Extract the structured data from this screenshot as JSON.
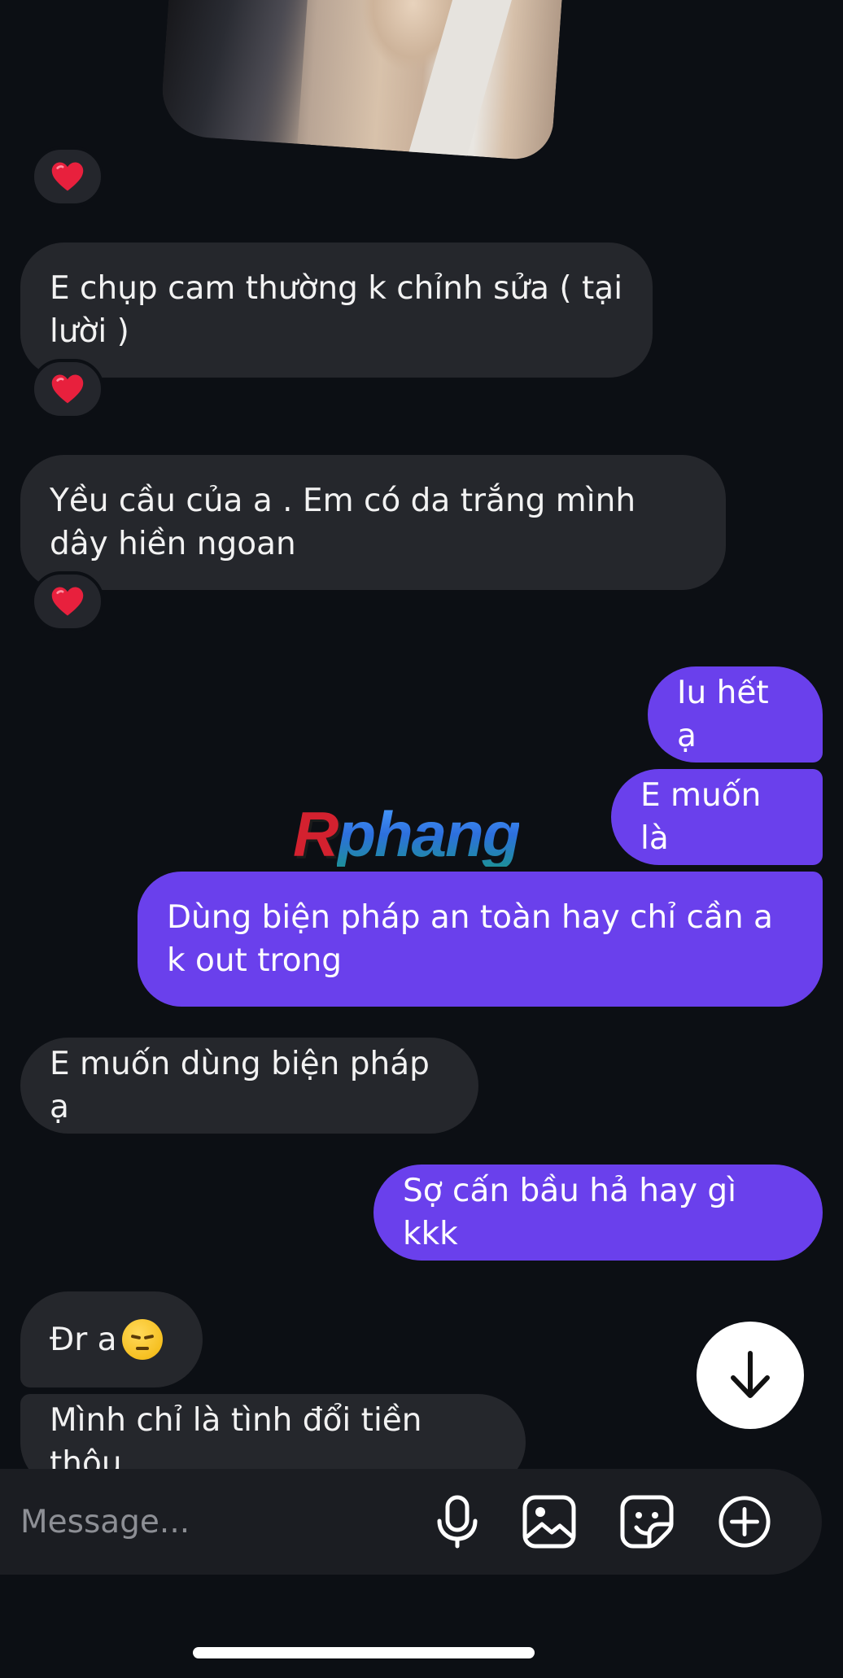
{
  "watermark": {
    "first": "R",
    "rest": "phang"
  },
  "messages": [
    {
      "text": "E chụp cam thường k chỉnh sửa ( tại lười )",
      "reaction": "❤️"
    },
    {
      "text": "Yều cầu của a . Em có da trắng mình dây hiền ngoan",
      "reaction": "❤️"
    },
    {
      "text": "Iu hết ạ"
    },
    {
      "text": "E muốn là"
    },
    {
      "text": "Dùng biện pháp an toàn hay chỉ cần a k out trong"
    },
    {
      "text": "E muốn dùng biện pháp ạ"
    },
    {
      "text": "Sợ cấn bầu hả hay gì kkk"
    },
    {
      "text": "Đr a",
      "emoji": "pensive-face"
    },
    {
      "text": "Mình chỉ là tình đổi tiền thôu"
    }
  ],
  "photo_reaction": "❤️",
  "composer": {
    "placeholder": "Message...",
    "icons": [
      "microphone-icon",
      "image-icon",
      "sticker-icon",
      "plus-circle-icon"
    ]
  },
  "scroll_button_icon": "arrow-down-icon",
  "colors": {
    "background": "#0c0f14",
    "incoming_bubble": "#25272c",
    "outgoing_bubble": "#6a40ec",
    "composer": "#1b1d22"
  }
}
